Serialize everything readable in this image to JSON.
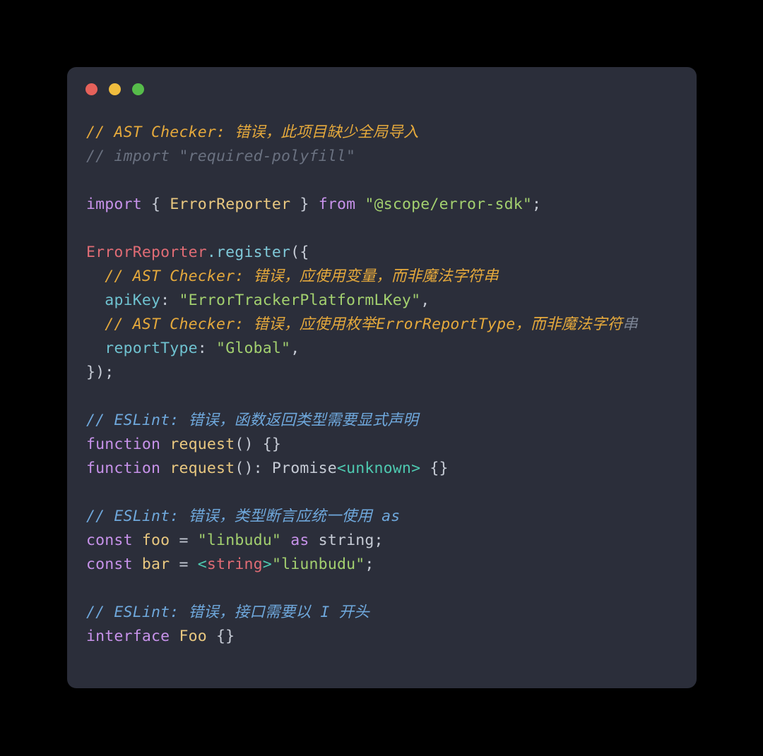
{
  "window": {
    "title": "",
    "background_color": "#2B2E3A",
    "page_background_color": "#000000",
    "traffic_lights": [
      {
        "name": "close",
        "color": "#E5615A"
      },
      {
        "name": "minimize",
        "color": "#EFBC3E"
      },
      {
        "name": "zoom",
        "color": "#56BC4A"
      }
    ]
  },
  "theme": {
    "comment_amber": "#E5A93C",
    "comment_gray": "#6A7180",
    "comment_blue": "#6FA8DC",
    "keyword": "#C792EA",
    "function": "#E9C880",
    "string": "#A3D06F",
    "object": "#E06C75",
    "method": "#7FC8D8",
    "property": "#6FC2D0",
    "generic": "#4EC9B0",
    "plain": "#C6CBD5"
  },
  "code": {
    "language": "typescript",
    "lines": [
      {
        "id": 1,
        "indent": 0,
        "text": "// AST Checker: 错误，此项目缺少全局导入",
        "tokens": [
          {
            "cls": "t-cmt-amber",
            "text": "// AST Checker: 错误，此项目缺少全局导入"
          }
        ]
      },
      {
        "id": 2,
        "indent": 0,
        "text": "// import \"required-polyfill\"",
        "tokens": [
          {
            "cls": "t-cmt-gray",
            "text": "// import \"required-polyfill\""
          }
        ]
      },
      {
        "id": 3,
        "indent": 0,
        "text": "",
        "tokens": []
      },
      {
        "id": 4,
        "indent": 0,
        "text": "import { ErrorReporter } from \"@scope/error-sdk\";",
        "tokens": [
          {
            "cls": "t-kw",
            "text": "import"
          },
          {
            "cls": "t-plain",
            "text": " "
          },
          {
            "cls": "t-punct",
            "text": "{"
          },
          {
            "cls": "t-plain",
            "text": " "
          },
          {
            "cls": "t-fn",
            "text": "ErrorReporter"
          },
          {
            "cls": "t-plain",
            "text": " "
          },
          {
            "cls": "t-punct",
            "text": "}"
          },
          {
            "cls": "t-plain",
            "text": " "
          },
          {
            "cls": "t-kw",
            "text": "from"
          },
          {
            "cls": "t-plain",
            "text": " "
          },
          {
            "cls": "t-str",
            "text": "\"@scope/error-sdk\""
          },
          {
            "cls": "t-punct",
            "text": ";"
          }
        ]
      },
      {
        "id": 5,
        "indent": 0,
        "text": "",
        "tokens": []
      },
      {
        "id": 6,
        "indent": 0,
        "text": "ErrorReporter.register({",
        "tokens": [
          {
            "cls": "t-obj",
            "text": "ErrorReporter"
          },
          {
            "cls": "t-method",
            "text": ".register"
          },
          {
            "cls": "t-punct",
            "text": "({"
          }
        ]
      },
      {
        "id": 7,
        "indent": 2,
        "text": "  // AST Checker: 错误，应使用变量，而非魔法字符串",
        "tokens": [
          {
            "cls": "t-plain",
            "text": "  "
          },
          {
            "cls": "t-cmt-amber",
            "text": "// AST Checker: 错误，应使用变量，而非魔法字符串"
          }
        ]
      },
      {
        "id": 8,
        "indent": 2,
        "text": "  apiKey: \"ErrorTrackerPlatformLKey\",",
        "tokens": [
          {
            "cls": "t-plain",
            "text": "  "
          },
          {
            "cls": "t-prop",
            "text": "apiKey"
          },
          {
            "cls": "t-punct",
            "text": ": "
          },
          {
            "cls": "t-str",
            "text": "\"ErrorTrackerPlatformLKey\""
          },
          {
            "cls": "t-punct",
            "text": ","
          }
        ]
      },
      {
        "id": 9,
        "indent": 2,
        "text": "  // AST Checker: 错误，应使用枚举ErrorReportType，而非魔法字符串",
        "tokens": [
          {
            "cls": "t-plain",
            "text": "  "
          },
          {
            "cls": "t-cmt-amber",
            "text": "// AST Checker: 错误，应使用枚举ErrorReportType，而非魔法字符"
          },
          {
            "cls": "t-cmt-dim",
            "text": "串"
          }
        ]
      },
      {
        "id": 10,
        "indent": 2,
        "text": "  reportType: \"Global\",",
        "tokens": [
          {
            "cls": "t-plain",
            "text": "  "
          },
          {
            "cls": "t-prop",
            "text": "reportType"
          },
          {
            "cls": "t-punct",
            "text": ": "
          },
          {
            "cls": "t-str",
            "text": "\"Global\""
          },
          {
            "cls": "t-punct",
            "text": ","
          }
        ]
      },
      {
        "id": 11,
        "indent": 0,
        "text": "});",
        "tokens": [
          {
            "cls": "t-punct",
            "text": "});"
          }
        ]
      },
      {
        "id": 12,
        "indent": 0,
        "text": "",
        "tokens": []
      },
      {
        "id": 13,
        "indent": 0,
        "text": "// ESLint: 错误，函数返回类型需要显式声明",
        "tokens": [
          {
            "cls": "t-cmt-blue",
            "text": "// ESLint: 错误，函数返回类型需要显式声明"
          }
        ]
      },
      {
        "id": 14,
        "indent": 0,
        "text": "function request() {}",
        "tokens": [
          {
            "cls": "t-kw",
            "text": "function"
          },
          {
            "cls": "t-plain",
            "text": " "
          },
          {
            "cls": "t-fn",
            "text": "request"
          },
          {
            "cls": "t-punct",
            "text": "() {}"
          }
        ]
      },
      {
        "id": 15,
        "indent": 0,
        "text": "function request(): Promise<unknown> {}",
        "tokens": [
          {
            "cls": "t-kw",
            "text": "function"
          },
          {
            "cls": "t-plain",
            "text": " "
          },
          {
            "cls": "t-fn",
            "text": "request"
          },
          {
            "cls": "t-punct",
            "text": "(): "
          },
          {
            "cls": "t-type",
            "text": "Promise"
          },
          {
            "cls": "t-generic",
            "text": "<unknown>"
          },
          {
            "cls": "t-punct",
            "text": " {}"
          }
        ]
      },
      {
        "id": 16,
        "indent": 0,
        "text": "",
        "tokens": []
      },
      {
        "id": 17,
        "indent": 0,
        "text": "// ESLint: 错误，类型断言应统一使用 as",
        "tokens": [
          {
            "cls": "t-cmt-blue",
            "text": "// ESLint: 错误，类型断言应统一使用 as"
          }
        ]
      },
      {
        "id": 18,
        "indent": 0,
        "text": "const foo = \"linbudu\" as string;",
        "tokens": [
          {
            "cls": "t-kw",
            "text": "const"
          },
          {
            "cls": "t-plain",
            "text": " "
          },
          {
            "cls": "t-fn",
            "text": "foo"
          },
          {
            "cls": "t-punct",
            "text": " = "
          },
          {
            "cls": "t-str",
            "text": "\"linbudu\""
          },
          {
            "cls": "t-plain",
            "text": " "
          },
          {
            "cls": "t-kw",
            "text": "as"
          },
          {
            "cls": "t-plain",
            "text": " "
          },
          {
            "cls": "t-type",
            "text": "string"
          },
          {
            "cls": "t-punct",
            "text": ";"
          }
        ]
      },
      {
        "id": 19,
        "indent": 0,
        "text": "const bar = <string>\"liunbudu\";",
        "tokens": [
          {
            "cls": "t-kw",
            "text": "const"
          },
          {
            "cls": "t-plain",
            "text": " "
          },
          {
            "cls": "t-fn",
            "text": "bar"
          },
          {
            "cls": "t-punct",
            "text": " = "
          },
          {
            "cls": "t-generic",
            "text": "<"
          },
          {
            "cls": "t-obj",
            "text": "string"
          },
          {
            "cls": "t-generic",
            "text": ">"
          },
          {
            "cls": "t-str",
            "text": "\"liunbudu\""
          },
          {
            "cls": "t-punct",
            "text": ";"
          }
        ]
      },
      {
        "id": 20,
        "indent": 0,
        "text": "",
        "tokens": []
      },
      {
        "id": 21,
        "indent": 0,
        "text": "// ESLint: 错误，接口需要以 I 开头",
        "tokens": [
          {
            "cls": "t-cmt-blue",
            "text": "// ESLint: 错误，接口需要以 I 开头"
          }
        ]
      },
      {
        "id": 22,
        "indent": 0,
        "text": "interface Foo {}",
        "tokens": [
          {
            "cls": "t-kw",
            "text": "interface"
          },
          {
            "cls": "t-plain",
            "text": " "
          },
          {
            "cls": "t-iface",
            "text": "Foo"
          },
          {
            "cls": "t-punct",
            "text": " {}"
          }
        ]
      }
    ]
  }
}
